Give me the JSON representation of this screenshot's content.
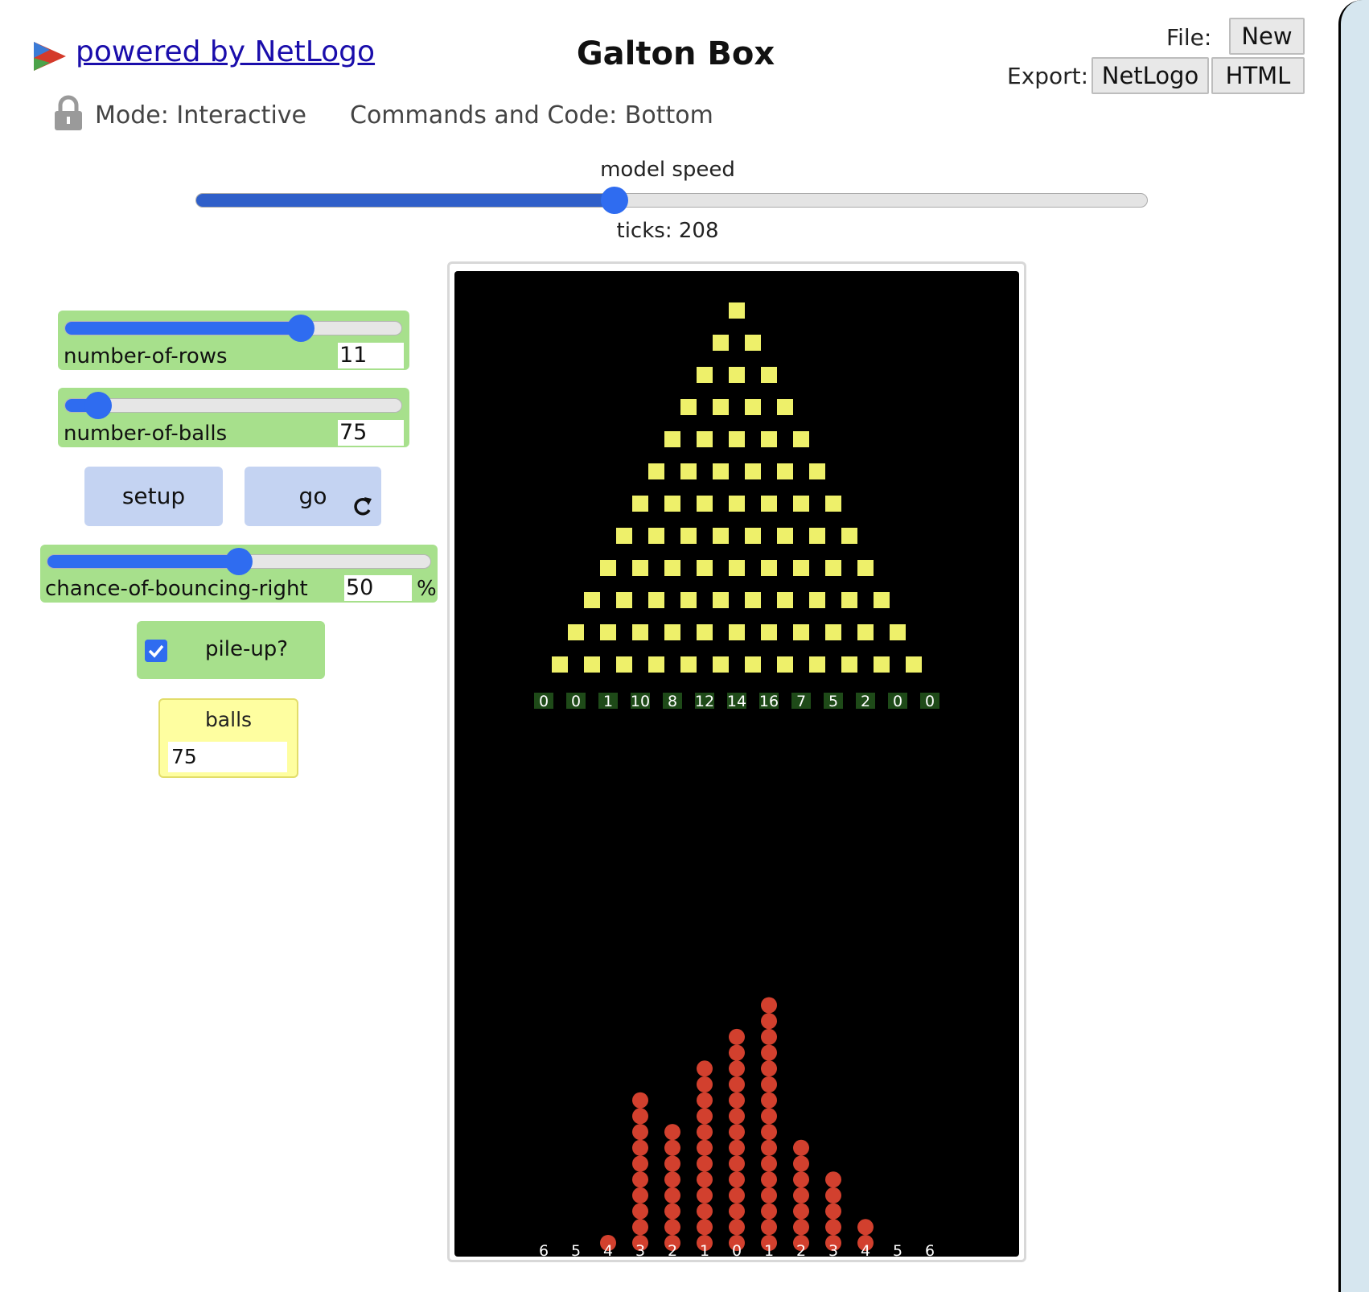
{
  "header": {
    "powered_by": "powered by NetLogo",
    "title": "Galton Box",
    "file_label": "File:",
    "export_label": "Export:",
    "new_button": "New",
    "netlogo_button": "NetLogo",
    "html_button": "HTML"
  },
  "toolbar": {
    "mode": "Mode: Interactive",
    "commands": "Commands and Code: Bottom"
  },
  "speed": {
    "label": "model speed",
    "fraction": 0.44,
    "ticks_text": "ticks: 208"
  },
  "widgets": {
    "rows_slider": {
      "label": "number-of-rows",
      "value": "11",
      "fraction": 0.7
    },
    "balls_slider": {
      "label": "number-of-balls",
      "value": "75",
      "fraction": 0.1
    },
    "setup_button": "setup",
    "go_button": "go",
    "bounce_slider": {
      "label": "chance-of-bouncing-right",
      "value": "50",
      "unit": "%",
      "fraction": 0.5
    },
    "pile_switch": {
      "label": "pile-up?",
      "checked": true
    },
    "balls_monitor": {
      "label": "balls",
      "value": "75"
    }
  },
  "world": {
    "peg_rows": 12,
    "bin_counts": [
      "0",
      "0",
      "1",
      "10",
      "8",
      "12",
      "14",
      "16",
      "7",
      "5",
      "2",
      "0",
      "0"
    ],
    "ball_stacks": [
      0,
      0,
      1,
      10,
      8,
      12,
      14,
      16,
      7,
      5,
      2,
      0,
      0
    ],
    "bottom_labels": [
      "6",
      "5",
      "4",
      "3",
      "2",
      "1",
      "0",
      "1",
      "2",
      "3",
      "4",
      "5",
      "6"
    ],
    "colors": {
      "peg": "#eef06a",
      "ball": "#d2402e",
      "label_bg": "#1e4a18",
      "background": "#000000"
    }
  },
  "colors": {
    "slider_bg": "#a7e08c",
    "button_bg": "#c4d3f2",
    "monitor_bg": "#fefea0",
    "accent": "#2f6cf0"
  }
}
